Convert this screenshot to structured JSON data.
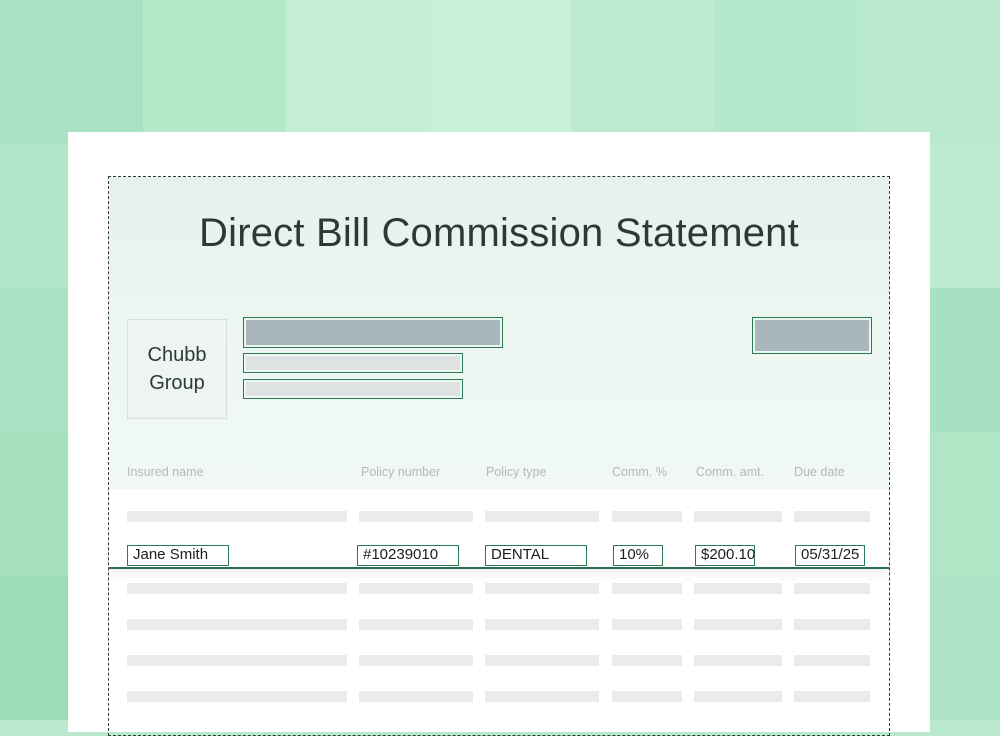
{
  "background": {
    "tile_colors": [
      "#a9e2c2",
      "#b6e8ca",
      "#c4efd6",
      "#c7f0d9",
      "#bdebd0",
      "#b4e7cb",
      "#b9e9ce",
      "#b2e6c8",
      "#b8e9cd",
      "#c8f0da",
      "#cdf2dd",
      "#c2eed5",
      "#b5e8cb",
      "#bcebd0",
      "#aae2c3",
      "#b1e5c7",
      "#c0eed4",
      "#c8f0d9",
      "#bfedd3",
      "#b0e5c7",
      "#a8e1c1",
      "#a5e0bf",
      "#b3e6c9",
      "#bdebd0",
      "#c4efd6",
      "#bbead0",
      "#b6e8cb",
      "#b0e5c6",
      "#9fddba",
      "#ade3c4",
      "#b7e8cc",
      "#bfecd2",
      "#b9e9ce",
      "#b2e6c8",
      "#aee4c5"
    ]
  },
  "document": {
    "title": "Direct Bill Commission Statement",
    "logo_text_line1": "Chubb",
    "logo_text_line2": "Group",
    "accent_color": "#2b7a55"
  },
  "table": {
    "columns": [
      "Insured name",
      "Policy number",
      "Policy type",
      "Comm. %",
      "Comm. amt.",
      "Due date"
    ],
    "selected_row": {
      "insured_name": "Jane Smith",
      "policy_number": "#10239010",
      "policy_type": "DENTAL",
      "comm_pct": "10%",
      "comm_amt": "$200.10",
      "due_date": "05/31/25"
    }
  }
}
